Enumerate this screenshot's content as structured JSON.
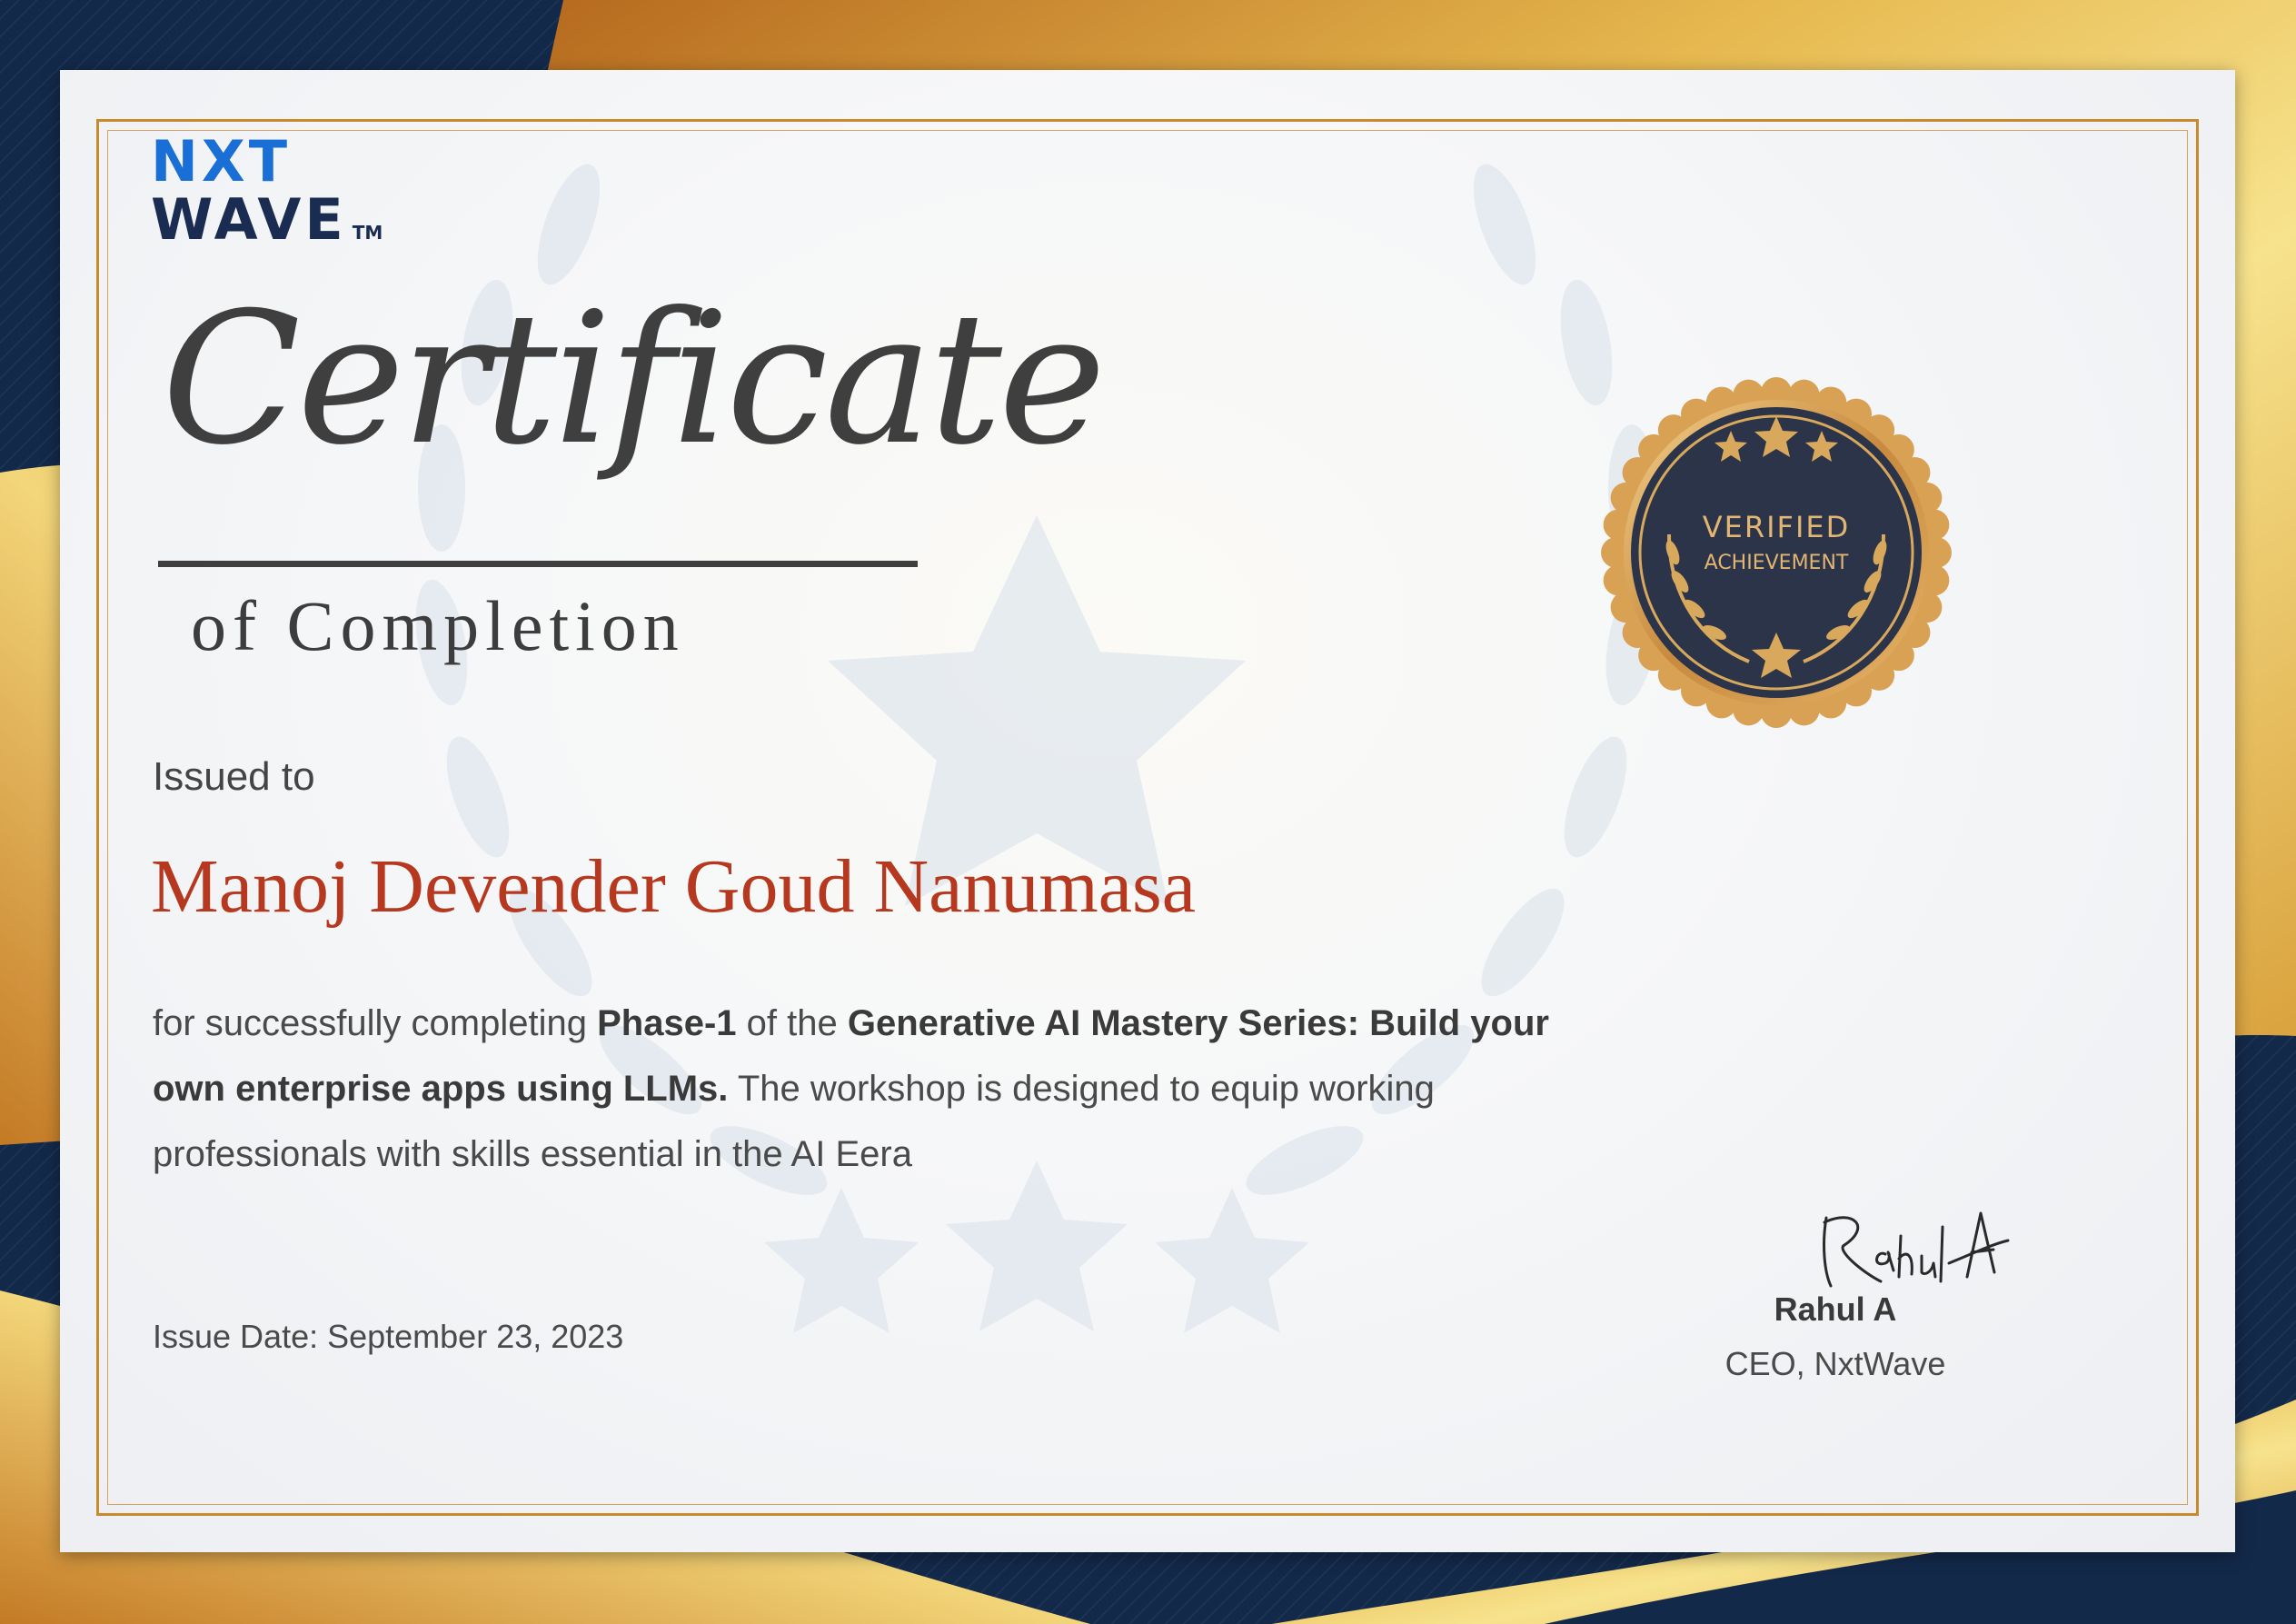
{
  "logo": {
    "line1": "NXT",
    "line2": "WAVE",
    "tm": "TM"
  },
  "certificate": {
    "title": "Certificate",
    "subtitle": "of Completion",
    "issued_to_label": "Issued to",
    "recipient": "Manoj Devender Goud Nanumasa",
    "description": {
      "part1": "for successfully completing ",
      "bold1": "Phase-1",
      "part2": " of the ",
      "bold2": "Generative AI Mastery Series: Build your own enterprise apps using LLMs.",
      "part3": " The workshop is designed to equip working professionals with skills essential in the AI Eera"
    },
    "issue_date": "Issue Date: September 23, 2023"
  },
  "seal": {
    "top_text": "VERIFIED",
    "bottom_text": "ACHIEVEMENT",
    "stars": 3
  },
  "signatory": {
    "signature_text": "Rahul A",
    "name": "Rahul A",
    "title": "CEO, NxtWave"
  },
  "colors": {
    "gold": "#d9a64a",
    "navy": "#0f2540",
    "recipient": "#b5381f",
    "text": "#444444",
    "logo_blue": "#1a6fd6",
    "logo_navy": "#1a2c52"
  }
}
